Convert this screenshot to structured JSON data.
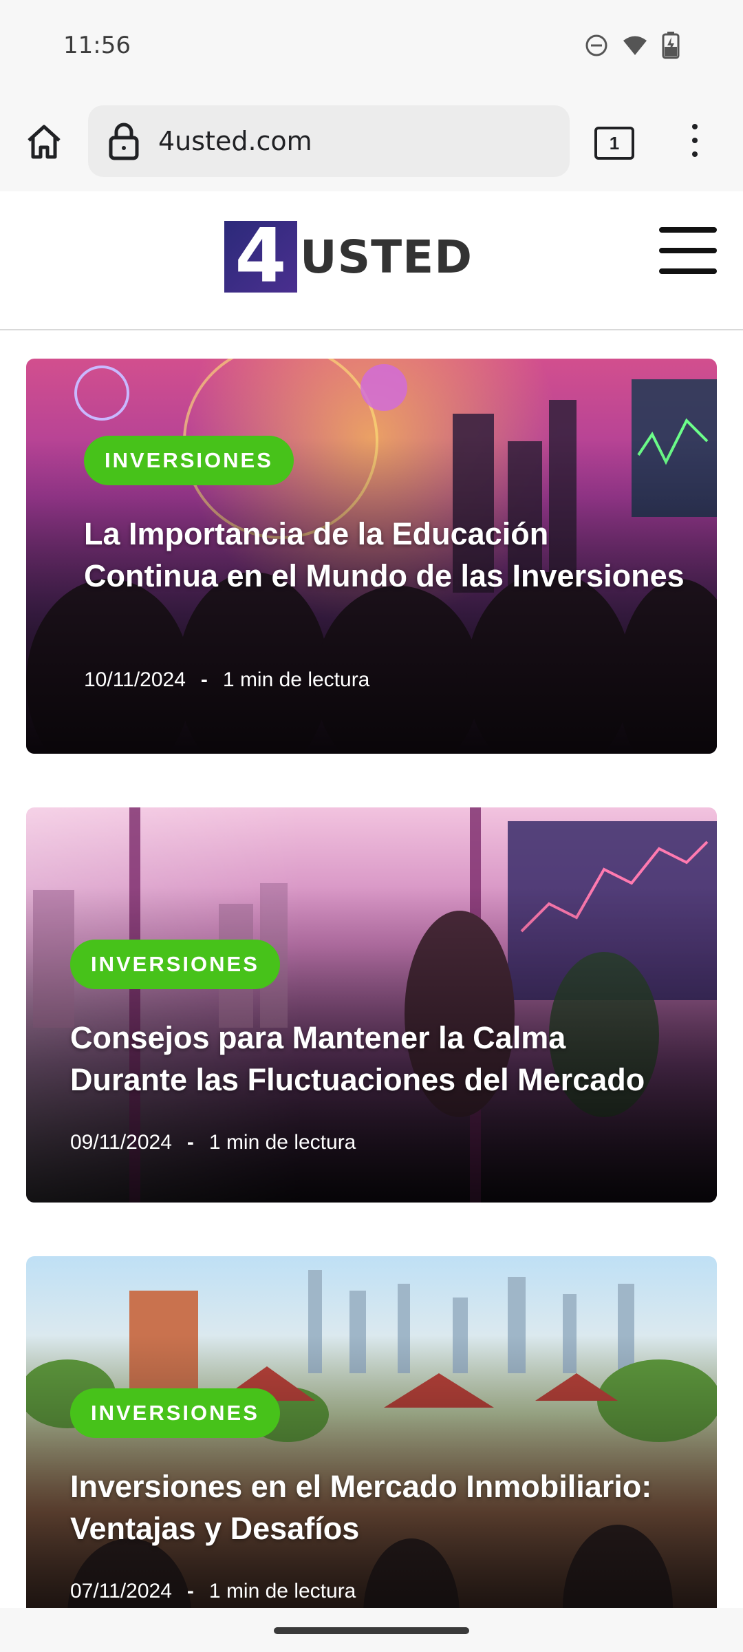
{
  "status_bar": {
    "time": "11:56",
    "icons": [
      "do-not-disturb-icon",
      "wifi-icon",
      "battery-charging-icon"
    ]
  },
  "browser": {
    "url": "4usted.com",
    "tab_count": "1"
  },
  "site": {
    "logo_mark": "4",
    "logo_word": "USTED"
  },
  "articles": [
    {
      "category": "INVERSIONES",
      "title": "La Importancia de la Educación Continua en el Mundo de las Inversiones",
      "date": "10/11/2024",
      "separator": "-",
      "read_time": "1 min de lectura"
    },
    {
      "category": "INVERSIONES",
      "title": "Consejos para Mantener la Calma Durante las Fluctuaciones del Mercado",
      "date": "09/11/2024",
      "separator": "-",
      "read_time": "1 min de lectura"
    },
    {
      "category": "INVERSIONES",
      "title": "Inversiones en el Mercado Inmobiliario: Ventajas y Desafíos",
      "date": "07/11/2024",
      "separator": "-",
      "read_time": "1 min de lectura"
    }
  ],
  "colors": {
    "badge": "#47c21a",
    "logo_mark": "#2c2a7a",
    "logo_word": "#333333"
  }
}
